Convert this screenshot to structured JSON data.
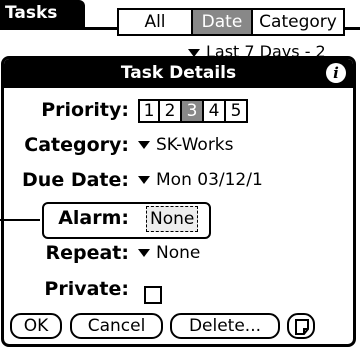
{
  "header": {
    "title": "Tasks",
    "tabs": [
      "All",
      "Date",
      "Category"
    ],
    "active_tab": "Date",
    "filter": "Last 7 Days - 2"
  },
  "dialog": {
    "title": "Task Details",
    "info_icon": "i",
    "priority": {
      "label": "Priority:",
      "options": [
        "1",
        "2",
        "3",
        "4",
        "5"
      ],
      "selected": "3"
    },
    "category": {
      "label": "Category:",
      "value": "SK-Works"
    },
    "due_date": {
      "label": "Due Date:",
      "value": "Mon 03/12/1"
    },
    "alarm": {
      "label": "Alarm:",
      "value": "None"
    },
    "repeat": {
      "label": "Repeat:",
      "value": "None"
    },
    "private": {
      "label": "Private:",
      "checked": false
    },
    "buttons": {
      "ok": "OK",
      "cancel": "Cancel",
      "delete": "Delete..."
    }
  },
  "colors": {
    "selected_bg": "#888888",
    "ink": "#000000",
    "paper": "#ffffff"
  },
  "icons": {
    "dropdown": "triangle-down-icon",
    "info": "info-icon",
    "note": "note-icon"
  }
}
